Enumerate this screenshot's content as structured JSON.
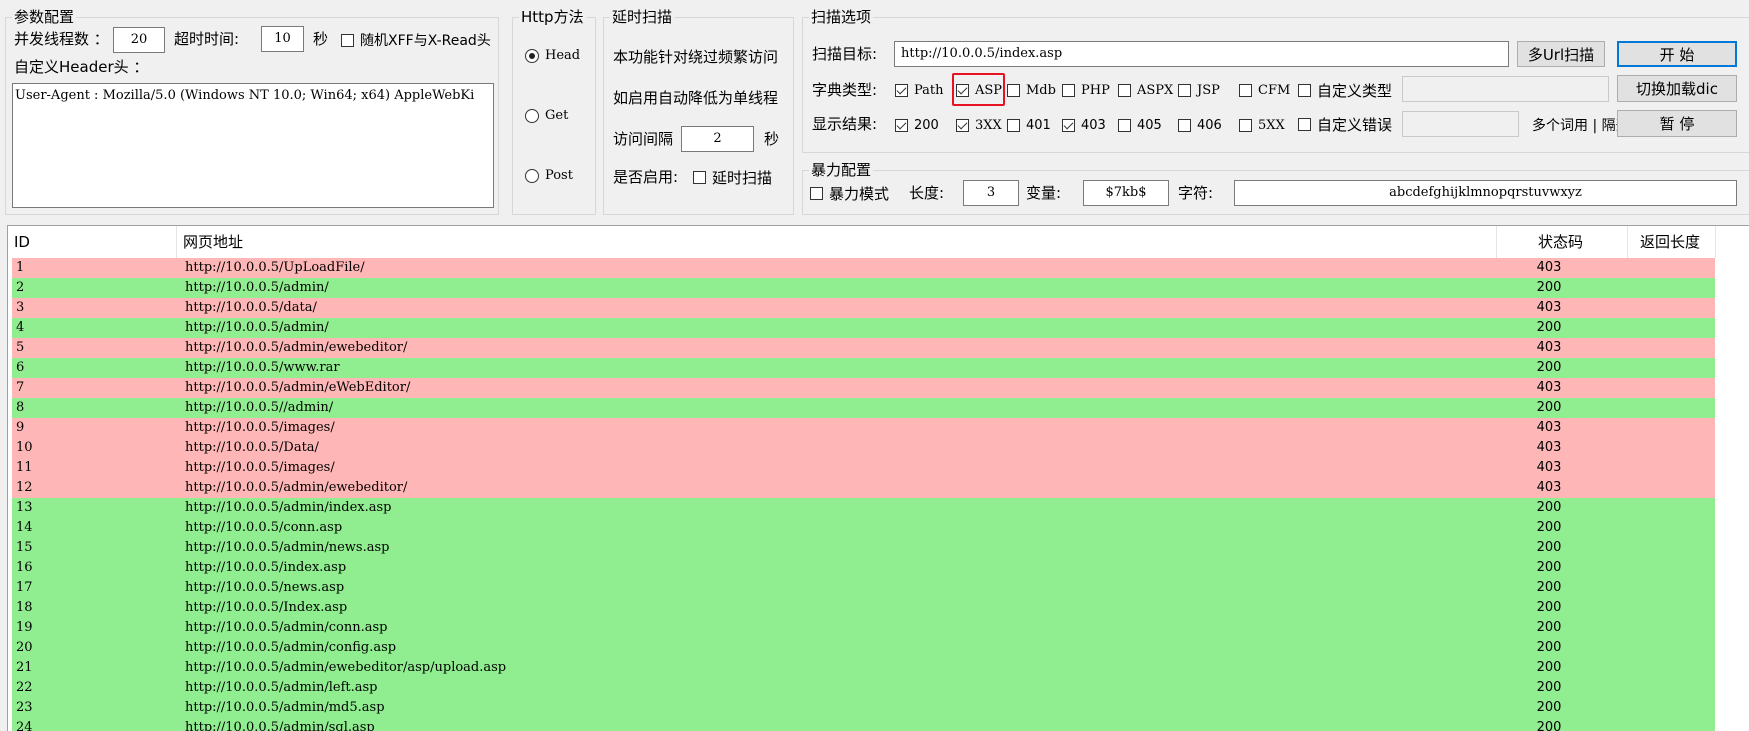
{
  "params": {
    "group_title": "参数配置",
    "threads_label": "并发线程数 ：",
    "threads_value": "20",
    "timeout_label": "超时时间:",
    "timeout_value": "10",
    "timeout_unit": "秒",
    "random_xff_label": "随机XFF与X-Read头",
    "header_label": "自定义Header头 ：",
    "header_value": "User-Agent : Mozilla/5.0 (Windows NT 10.0; Win64; x64) AppleWebKi"
  },
  "http_method": {
    "group_title": "Http方法",
    "options": [
      "Head",
      "Get",
      "Post"
    ],
    "selected": "Head"
  },
  "delay": {
    "group_title": "延时扫描",
    "line1": "本功能针对绕过频繁访问",
    "line2": "如启用自动降低为单线程",
    "interval_label": "访问间隔",
    "interval_value": "2",
    "interval_unit": "秒",
    "enable_label": "是否启用:",
    "enable_checkbox": "延时扫描"
  },
  "scan": {
    "group_title": "扫描选项",
    "target_label": "扫描目标:",
    "target_value": "http://10.0.0.5/index.asp",
    "multi_url_button": "多Url扫描",
    "start_button": "开 始",
    "dict_label": "字典类型:",
    "dict_types": [
      {
        "label": "Path",
        "checked": true
      },
      {
        "label": "ASP",
        "checked": true
      },
      {
        "label": "Mdb",
        "checked": false
      },
      {
        "label": "PHP",
        "checked": false
      },
      {
        "label": "ASPX",
        "checked": false
      },
      {
        "label": "JSP",
        "checked": false
      },
      {
        "label": "CFM",
        "checked": false
      }
    ],
    "custom_type_label": "自定义类型",
    "switch_dict_button": "切换加载dic",
    "result_label": "显示结果:",
    "result_codes": [
      {
        "label": "200",
        "checked": true
      },
      {
        "label": "3XX",
        "checked": true
      },
      {
        "label": "401",
        "checked": false
      },
      {
        "label": "403",
        "checked": true
      },
      {
        "label": "405",
        "checked": false
      },
      {
        "label": "406",
        "checked": false
      },
      {
        "label": "5XX",
        "checked": false
      }
    ],
    "custom_error_label": "自定义错误",
    "multi_word_hint": "多个词用 | 隔开",
    "pause_button": "暂 停"
  },
  "brute": {
    "group_title": "暴力配置",
    "mode_label": "暴力模式",
    "length_label": "长度:",
    "length_value": "3",
    "var_label": "变量:",
    "var_value": "$7kb$",
    "chars_label": "字符:",
    "chars_value": "abcdefghijklmnopqrstuvwxyz"
  },
  "table": {
    "columns": [
      "ID",
      "网页地址",
      "状态码",
      "返回长度"
    ],
    "rows": [
      {
        "id": "1",
        "url": "http://10.0.0.5/UpLoadFile/",
        "status": "403"
      },
      {
        "id": "2",
        "url": "http://10.0.0.5/admin/",
        "status": "200"
      },
      {
        "id": "3",
        "url": "http://10.0.0.5/data/",
        "status": "403"
      },
      {
        "id": "4",
        "url": "http://10.0.0.5/admin/",
        "status": "200"
      },
      {
        "id": "5",
        "url": "http://10.0.0.5/admin/ewebeditor/",
        "status": "403"
      },
      {
        "id": "6",
        "url": "http://10.0.0.5/www.rar",
        "status": "200"
      },
      {
        "id": "7",
        "url": "http://10.0.0.5/admin/eWebEditor/",
        "status": "403"
      },
      {
        "id": "8",
        "url": "http://10.0.0.5//admin/",
        "status": "200"
      },
      {
        "id": "9",
        "url": "http://10.0.0.5/images/",
        "status": "403"
      },
      {
        "id": "10",
        "url": "http://10.0.0.5/Data/",
        "status": "403"
      },
      {
        "id": "11",
        "url": "http://10.0.0.5/images/",
        "status": "403"
      },
      {
        "id": "12",
        "url": "http://10.0.0.5/admin/ewebeditor/",
        "status": "403"
      },
      {
        "id": "13",
        "url": "http://10.0.0.5/admin/index.asp",
        "status": "200"
      },
      {
        "id": "14",
        "url": "http://10.0.0.5/conn.asp",
        "status": "200"
      },
      {
        "id": "15",
        "url": "http://10.0.0.5/admin/news.asp",
        "status": "200"
      },
      {
        "id": "16",
        "url": "http://10.0.0.5/index.asp",
        "status": "200"
      },
      {
        "id": "17",
        "url": "http://10.0.0.5/news.asp",
        "status": "200"
      },
      {
        "id": "18",
        "url": "http://10.0.0.5/Index.asp",
        "status": "200"
      },
      {
        "id": "19",
        "url": "http://10.0.0.5/admin/conn.asp",
        "status": "200"
      },
      {
        "id": "20",
        "url": "http://10.0.0.5/admin/config.asp",
        "status": "200"
      },
      {
        "id": "21",
        "url": "http://10.0.0.5/admin/ewebeditor/asp/upload.asp",
        "status": "200"
      },
      {
        "id": "22",
        "url": "http://10.0.0.5/admin/left.asp",
        "status": "200"
      },
      {
        "id": "23",
        "url": "http://10.0.0.5/admin/md5.asp",
        "status": "200"
      },
      {
        "id": "24",
        "url": "http://10.0.0.5/admin/sql.asp",
        "status": "200"
      }
    ]
  },
  "colors": {
    "row_403": "#ffb6b6",
    "row_200": "#90ee90",
    "highlight": "#e81123"
  }
}
